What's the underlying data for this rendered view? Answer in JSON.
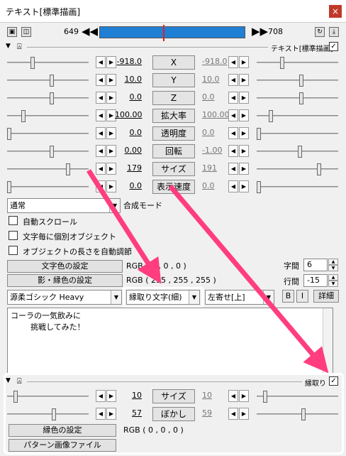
{
  "window": {
    "title": "テキスト[標準描画]",
    "close_label": "×"
  },
  "frames": {
    "start": "649",
    "end": "708",
    "prev": "◀◀",
    "next": "▶▶"
  },
  "object": {
    "label": "テキスト[標準描画]",
    "enabled": "✓"
  },
  "tracks": [
    {
      "left": "-918.0",
      "name": "X",
      "right": "-918.0"
    },
    {
      "left": "10.0",
      "name": "Y",
      "right": "10.0"
    },
    {
      "left": "0.0",
      "name": "Z",
      "right": "0.0"
    },
    {
      "left": "100.00",
      "name": "拡大率",
      "right": "100.00"
    },
    {
      "left": "0.0",
      "name": "透明度",
      "right": "0.0"
    },
    {
      "left": "0.00",
      "name": "回転",
      "right": "-1.00"
    },
    {
      "left": "179",
      "name": "サイズ",
      "right": "191"
    },
    {
      "left": "0.0",
      "name": "表示速度",
      "right": "0.0"
    }
  ],
  "arrows": {
    "left": "◀",
    "right": "▶",
    "down": "▼"
  },
  "blend": {
    "value": "通常",
    "label": "合成モード"
  },
  "options": [
    {
      "label": "自動スクロール"
    },
    {
      "label": "文字毎に個別オブジェクト"
    },
    {
      "label": "オブジェクトの長さを自動調節"
    }
  ],
  "color": {
    "text_color_button": "文字色の設定",
    "text_color_value": "RGB ( 0 , 0 , 0 )",
    "shadow_color_button": "影・縁色の設定",
    "shadow_color_value": "RGB ( 255 , 255 , 255 )"
  },
  "spacing": {
    "char_label": "字間",
    "char_value": "6",
    "line_label": "行間",
    "line_value": "-15"
  },
  "font": {
    "name": "源柔ゴシック Heavy",
    "style": "縁取り文字(細)",
    "align": "左寄せ[上]",
    "bold": "B",
    "italic": "I",
    "detail": "詳細"
  },
  "text_content": [
    "コーラの一気飲みに",
    "        挑戦してみた！"
  ],
  "outline": {
    "label": "縁取り",
    "enabled": "✓",
    "tracks": [
      {
        "left": "10",
        "name": "サイズ",
        "right": "10"
      },
      {
        "left": "57",
        "name": "ぼかし",
        "right": "59"
      }
    ],
    "color_button": "縁色の設定",
    "color_value": "RGB ( 0 , 0 , 0 )",
    "pattern_button": "パターン画像ファイル"
  },
  "colors": {
    "accent_arrow": "#ff3d7f",
    "timeline": "#1f7fd4",
    "close": "#c0392b"
  }
}
